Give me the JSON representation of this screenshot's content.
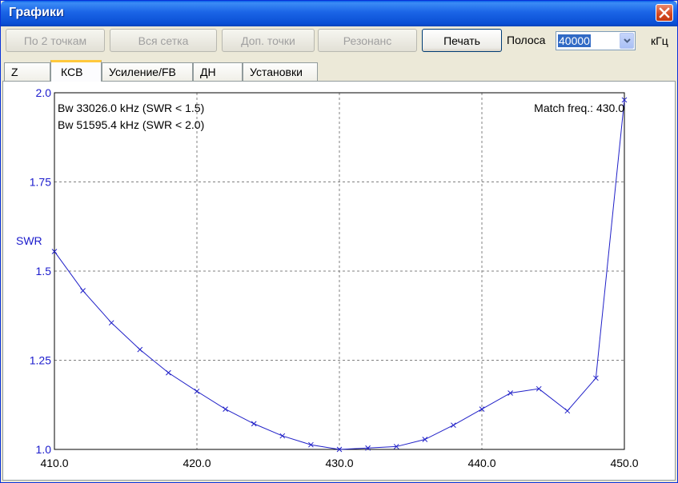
{
  "window": {
    "title": "Графики"
  },
  "toolbar": {
    "btn_two_points": "По 2 точкам",
    "btn_all_grid": "Вся сетка",
    "btn_extra_points": "Доп. точки",
    "btn_resonance": "Резонанс",
    "btn_print": "Печать",
    "band_label": "Полоса",
    "band_value": "40000",
    "band_unit": "кГц"
  },
  "tabs": [
    {
      "label": "Z",
      "active": false
    },
    {
      "label": "КСВ",
      "active": true
    },
    {
      "label": "Усиление/FB",
      "active": false
    },
    {
      "label": "ДН",
      "active": false
    },
    {
      "label": "Установки",
      "active": false
    }
  ],
  "chart_data": {
    "type": "line",
    "ylabel": "SWR",
    "xlabel": "",
    "xlim": [
      410.0,
      450.0
    ],
    "ylim": [
      1.0,
      2.0
    ],
    "x_ticks": [
      "410.0",
      "420.0",
      "430.0",
      "440.0",
      "450.0"
    ],
    "y_ticks": [
      "1.0",
      "1.25",
      "1.5",
      "1.75",
      "2.0"
    ],
    "grid": true,
    "annotations": {
      "bw1": "Bw 33026.0 kHz (SWR < 1.5)",
      "bw2": "Bw 51595.4 kHz (SWR < 2.0)",
      "match": "Match freq.: 430.0"
    },
    "line_color": "#2020c8",
    "axis_label_color": "#1a1acc",
    "series": [
      {
        "x": [
          410,
          412,
          414,
          416,
          418,
          420,
          422,
          424,
          426,
          428,
          430,
          432,
          434,
          436,
          438,
          440,
          442,
          444,
          446,
          448,
          450
        ],
        "y": [
          1.555,
          1.445,
          1.355,
          1.28,
          1.215,
          1.163,
          1.113,
          1.072,
          1.038,
          1.013,
          1.0,
          1.004,
          1.008,
          1.028,
          1.068,
          1.113,
          1.158,
          1.17,
          1.108,
          1.2,
          1.98
        ]
      }
    ]
  }
}
